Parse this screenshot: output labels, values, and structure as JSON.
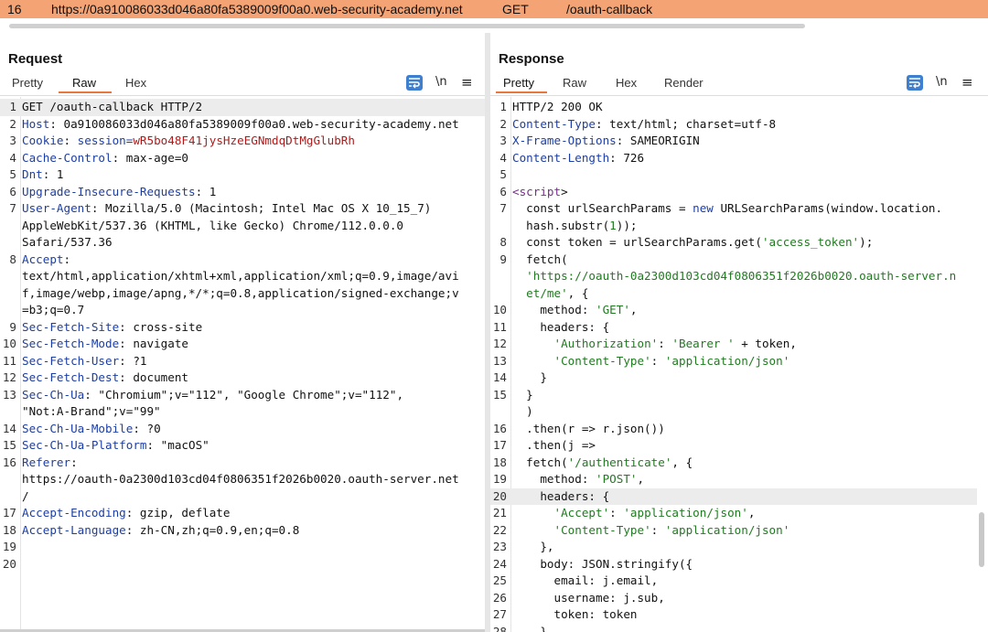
{
  "topbar": {
    "row_number": "16",
    "host": "https://0a910086033d046a80fa5389009f00a0.web-security-academy.net",
    "method": "GET",
    "path": "/oauth-callback",
    "bg_color": "#f4a374"
  },
  "request": {
    "title": "Request",
    "tabs": [
      {
        "label": "Pretty",
        "active": false
      },
      {
        "label": "Raw",
        "active": true
      },
      {
        "label": "Hex",
        "active": false
      }
    ],
    "icons": {
      "wrap": "word-wrap-icon",
      "newline": "\\n",
      "menu": "≡"
    },
    "lines": [
      {
        "n": "1",
        "key": "",
        "sep": "",
        "val": "GET /oauth-callback HTTP/2",
        "hl": true
      },
      {
        "n": "2",
        "key": "Host",
        "sep": ": ",
        "val": "0a910086033d046a80fa5389009f00a0.web-security-academy.net"
      },
      {
        "n": "3",
        "key": "Cookie",
        "sep": ": ",
        "val": "session=",
        "val2": "wR5bo48F41jysHzeEGNmdqDtMgGlubRh"
      },
      {
        "n": "4",
        "key": "Cache-Control",
        "sep": ": ",
        "val": "max-age=0"
      },
      {
        "n": "5",
        "key": "Dnt",
        "sep": ": ",
        "val": "1"
      },
      {
        "n": "6",
        "key": "Upgrade-Insecure-Requests",
        "sep": ": ",
        "val": "1"
      },
      {
        "n": "7",
        "key": "User-Agent",
        "sep": ": ",
        "val": "Mozilla/5.0 (Macintosh; Intel Mac OS X 10_15_7)"
      },
      {
        "n": "",
        "key": "",
        "sep": "",
        "val": "AppleWebKit/537.36 (KHTML, like Gecko) Chrome/112.0.0.0"
      },
      {
        "n": "",
        "key": "",
        "sep": "",
        "val": "Safari/537.36"
      },
      {
        "n": "8",
        "key": "Accept",
        "sep": ":",
        "val": ""
      },
      {
        "n": "",
        "key": "",
        "sep": "",
        "val": "text/html,application/xhtml+xml,application/xml;q=0.9,image/avi"
      },
      {
        "n": "",
        "key": "",
        "sep": "",
        "val": "f,image/webp,image/apng,*/*;q=0.8,application/signed-exchange;v"
      },
      {
        "n": "",
        "key": "",
        "sep": "",
        "val": "=b3;q=0.7"
      },
      {
        "n": "9",
        "key": "Sec-Fetch-Site",
        "sep": ": ",
        "val": "cross-site"
      },
      {
        "n": "10",
        "key": "Sec-Fetch-Mode",
        "sep": ": ",
        "val": "navigate"
      },
      {
        "n": "11",
        "key": "Sec-Fetch-User",
        "sep": ": ",
        "val": "?1"
      },
      {
        "n": "12",
        "key": "Sec-Fetch-Dest",
        "sep": ": ",
        "val": "document"
      },
      {
        "n": "13",
        "key": "Sec-Ch-Ua",
        "sep": ": ",
        "val": "\"Chromium\";v=\"112\", \"Google Chrome\";v=\"112\","
      },
      {
        "n": "",
        "key": "",
        "sep": "",
        "val": "\"Not:A-Brand\";v=\"99\""
      },
      {
        "n": "14",
        "key": "Sec-Ch-Ua-Mobile",
        "sep": ": ",
        "val": "?0"
      },
      {
        "n": "15",
        "key": "Sec-Ch-Ua-Platform",
        "sep": ": ",
        "val": "\"macOS\""
      },
      {
        "n": "16",
        "key": "Referer",
        "sep": ":",
        "val": ""
      },
      {
        "n": "",
        "key": "",
        "sep": "",
        "val": "https://oauth-0a2300d103cd04f0806351f2026b0020.oauth-server.net"
      },
      {
        "n": "",
        "key": "",
        "sep": "",
        "val": "/"
      },
      {
        "n": "17",
        "key": "Accept-Encoding",
        "sep": ": ",
        "val": "gzip, deflate"
      },
      {
        "n": "18",
        "key": "Accept-Language",
        "sep": ": ",
        "val": "zh-CN,zh;q=0.9,en;q=0.8"
      },
      {
        "n": "19",
        "key": "",
        "sep": "",
        "val": ""
      },
      {
        "n": "20",
        "key": "",
        "sep": "",
        "val": ""
      }
    ]
  },
  "response": {
    "title": "Response",
    "tabs": [
      {
        "label": "Pretty",
        "active": true
      },
      {
        "label": "Raw",
        "active": false
      },
      {
        "label": "Hex",
        "active": false
      },
      {
        "label": "Render",
        "active": false
      }
    ],
    "view_toggle": [
      "split-horizontal",
      "split-vertical",
      "single-pane"
    ],
    "lines": [
      {
        "n": "1",
        "segs": [
          [
            "v",
            "HTTP/2 200 OK"
          ]
        ]
      },
      {
        "n": "2",
        "segs": [
          [
            "k",
            "Content-Type"
          ],
          [
            "v",
            ": text/html; charset=utf-8"
          ]
        ]
      },
      {
        "n": "3",
        "segs": [
          [
            "k",
            "X-Frame-Options"
          ],
          [
            "v",
            ": SAMEORIGIN"
          ]
        ]
      },
      {
        "n": "4",
        "segs": [
          [
            "k",
            "Content-Length"
          ],
          [
            "v",
            ": 726"
          ]
        ]
      },
      {
        "n": "5",
        "segs": []
      },
      {
        "n": "6",
        "segs": [
          [
            "tag",
            "<script"
          ],
          [
            "v",
            ">"
          ]
        ]
      },
      {
        "n": "7",
        "segs": [
          [
            "v",
            "  const urlSearchParams = "
          ],
          [
            "kw",
            "new"
          ],
          [
            "v",
            " URLSearchParams(window.location."
          ]
        ]
      },
      {
        "n": "",
        "segs": [
          [
            "v",
            "  hash.substr("
          ],
          [
            "str",
            "1"
          ],
          [
            "v",
            "));"
          ]
        ]
      },
      {
        "n": "8",
        "segs": [
          [
            "v",
            "  const token = urlSearchParams.get("
          ],
          [
            "str",
            "'access_token'"
          ],
          [
            "v",
            ");"
          ]
        ]
      },
      {
        "n": "9",
        "segs": [
          [
            "v",
            "  fetch("
          ]
        ]
      },
      {
        "n": "",
        "segs": [
          [
            "str",
            "  'https://oauth-0a2300d103cd04f0806351f2026b0020.oauth-server.n"
          ]
        ]
      },
      {
        "n": "",
        "segs": [
          [
            "str",
            "  et/me'"
          ],
          [
            "v",
            ", {"
          ]
        ]
      },
      {
        "n": "10",
        "segs": [
          [
            "v",
            "    method: "
          ],
          [
            "str",
            "'GET'"
          ],
          [
            "v",
            ","
          ]
        ]
      },
      {
        "n": "11",
        "segs": [
          [
            "v",
            "    headers: {"
          ]
        ]
      },
      {
        "n": "12",
        "segs": [
          [
            "v",
            "      "
          ],
          [
            "str",
            "'Authorization'"
          ],
          [
            "v",
            ": "
          ],
          [
            "str",
            "'Bearer '"
          ],
          [
            "v",
            " + token,"
          ]
        ]
      },
      {
        "n": "13",
        "segs": [
          [
            "v",
            "      "
          ],
          [
            "str",
            "'Content-Type'"
          ],
          [
            "v",
            ": "
          ],
          [
            "str",
            "'application/json'"
          ]
        ]
      },
      {
        "n": "14",
        "segs": [
          [
            "v",
            "    }"
          ]
        ]
      },
      {
        "n": "15",
        "segs": [
          [
            "v",
            "  }"
          ]
        ]
      },
      {
        "n": "",
        "segs": [
          [
            "v",
            "  )"
          ]
        ]
      },
      {
        "n": "16",
        "segs": [
          [
            "v",
            "  .then(r => r.json())"
          ]
        ]
      },
      {
        "n": "17",
        "segs": [
          [
            "v",
            "  .then(j =>"
          ]
        ]
      },
      {
        "n": "18",
        "segs": [
          [
            "v",
            "  fetch("
          ],
          [
            "str",
            "'/authenticate'"
          ],
          [
            "v",
            ", {"
          ]
        ]
      },
      {
        "n": "19",
        "segs": [
          [
            "v",
            "    method: "
          ],
          [
            "str",
            "'POST'"
          ],
          [
            "v",
            ","
          ]
        ]
      },
      {
        "n": "20",
        "segs": [
          [
            "v",
            "    headers: {"
          ]
        ],
        "hl": true
      },
      {
        "n": "21",
        "segs": [
          [
            "v",
            "      "
          ],
          [
            "str",
            "'Accept'"
          ],
          [
            "v",
            ": "
          ],
          [
            "str",
            "'application/json'"
          ],
          [
            "v",
            ","
          ]
        ]
      },
      {
        "n": "22",
        "segs": [
          [
            "v",
            "      "
          ],
          [
            "str",
            "'Content-Type'"
          ],
          [
            "v",
            ": "
          ],
          [
            "str",
            "'application/json'"
          ]
        ]
      },
      {
        "n": "23",
        "segs": [
          [
            "v",
            "    },"
          ]
        ]
      },
      {
        "n": "24",
        "segs": [
          [
            "v",
            "    body: JSON.stringify({"
          ]
        ]
      },
      {
        "n": "25",
        "segs": [
          [
            "v",
            "      email: j.email,"
          ]
        ]
      },
      {
        "n": "26",
        "segs": [
          [
            "v",
            "      username: j.sub,"
          ]
        ]
      },
      {
        "n": "27",
        "segs": [
          [
            "v",
            "      token: token"
          ]
        ]
      },
      {
        "n": "28",
        "segs": [
          [
            "v",
            "    }"
          ]
        ]
      }
    ]
  }
}
